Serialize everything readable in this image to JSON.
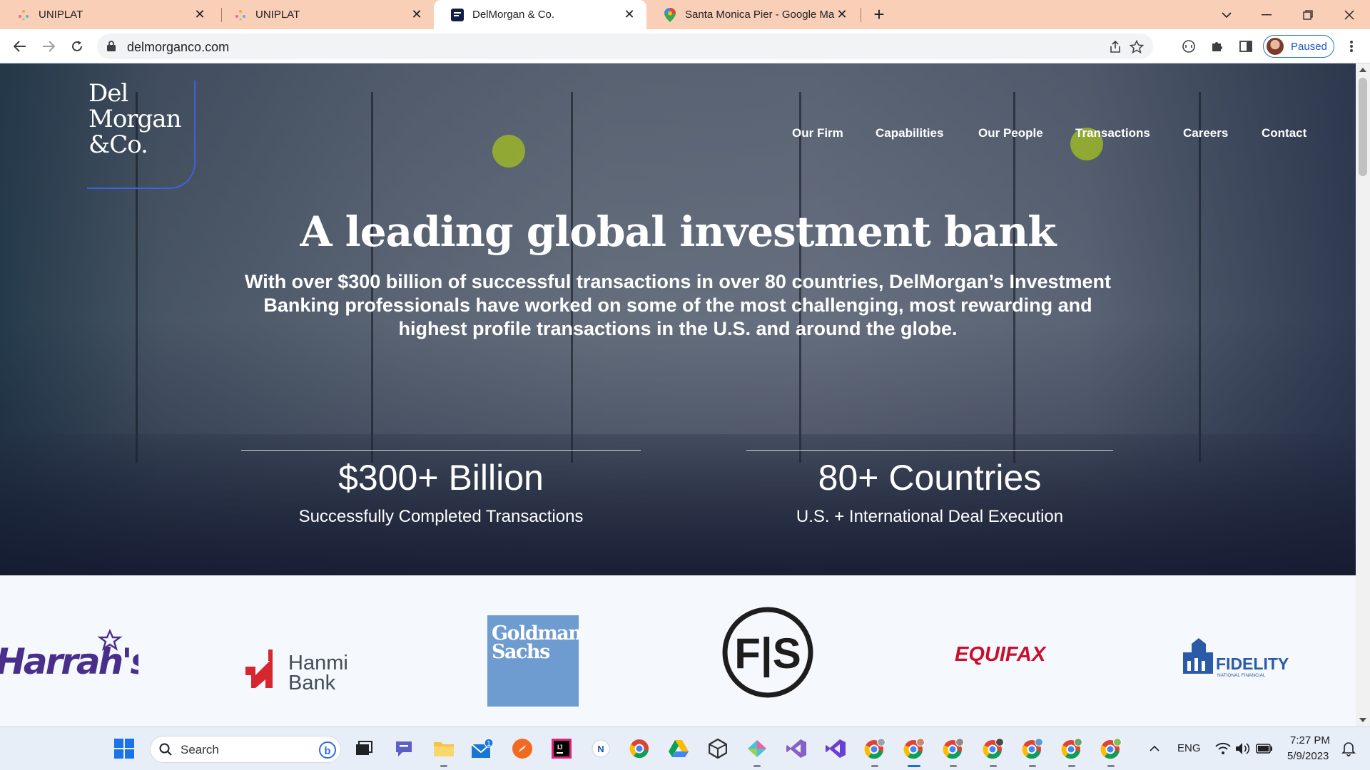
{
  "browser": {
    "tabs": [
      {
        "title": "UNIPLAT",
        "favicon": "uniplat-icon"
      },
      {
        "title": "UNIPLAT",
        "favicon": "uniplat-icon"
      },
      {
        "title": "DelMorgan & Co.",
        "favicon": "delmorgan-icon",
        "active": true
      },
      {
        "title": "Santa Monica Pier - Google Map",
        "favicon": "google-maps-icon"
      }
    ],
    "url": "delmorganco.com",
    "profile_label": "Paused"
  },
  "site": {
    "logo": {
      "line1": "Del",
      "line2": "Morgan",
      "line3": "&Co."
    },
    "nav": [
      "Our Firm",
      "Capabilities",
      "Our People",
      "Transactions",
      "Careers",
      "Contact"
    ],
    "headline": "A leading global investment bank",
    "subtext": "With over $300 billion of successful transactions in over 80 countries, DelMorgan’s Investment Banking professionals have worked on some of the most challenging, most rewarding and highest profile transactions in the U.S. and around the globe.",
    "stats": [
      {
        "value": "$300+ Billion",
        "label": "Successfully Completed Transactions"
      },
      {
        "value": "80+ Countries",
        "label": "U.S. + International Deal Execution"
      }
    ],
    "clients": {
      "harrahs": "Harrah's",
      "hanmi_line1": "Hanmi",
      "hanmi_line2": "Bank",
      "goldman_line1": "Goldman",
      "goldman_line2": "Sachs",
      "fs": "F|S",
      "equifax": "EQUIFAX",
      "fidelity": "FIDELITY",
      "fidelity_sub": "NATIONAL FINANCIAL"
    }
  },
  "taskbar": {
    "search_label": "Search",
    "language": "ENG",
    "time": "7:27 PM",
    "date": "5/9/2023",
    "mail_badge": "1"
  },
  "colors": {
    "tabstrip": "#f9cfb8",
    "accent_blue": "#3e63d8",
    "hanmi_red": "#d62630",
    "equifax_red": "#c8102e",
    "goldman_blue": "#6e9bd0",
    "fidelity_blue": "#2b5aa8"
  }
}
